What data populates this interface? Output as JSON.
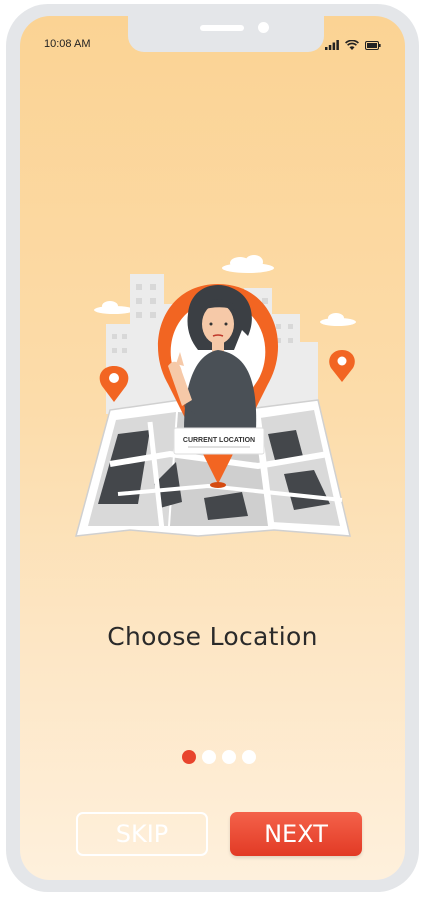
{
  "status_bar": {
    "time": "10:08 AM",
    "icons": [
      "signal-icon",
      "wifi-icon",
      "battery-icon"
    ]
  },
  "illustration": {
    "label": "CURRENT LOCATION",
    "icon": "location-pin-illustration"
  },
  "onboarding": {
    "title": "Choose Location",
    "page_count": 4,
    "active_page": 1
  },
  "buttons": {
    "skip_label": "SKIP",
    "next_label": "NEXT"
  },
  "colors": {
    "accent": "#e8442d",
    "pin": "#f26522",
    "bg_top": "#fbd394",
    "bg_bottom": "#fef0dc"
  }
}
